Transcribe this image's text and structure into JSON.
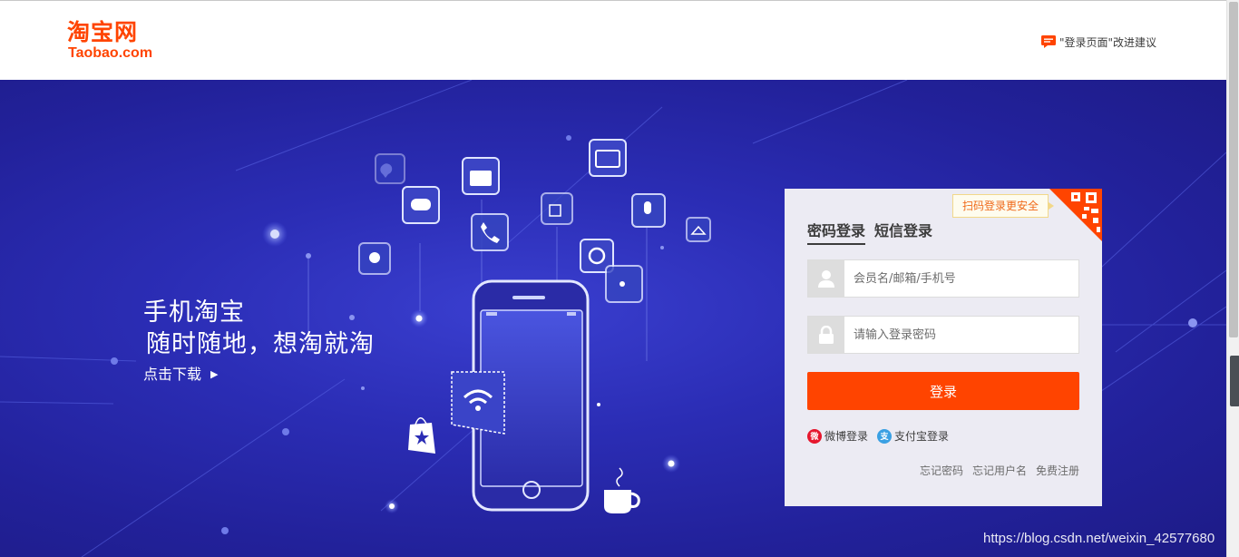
{
  "header": {
    "logo_cn": "淘宝网",
    "logo_en": "Taobao.com",
    "feedback_text": "\"登录页面\"改进建议",
    "icon": "feedback-chat-icon"
  },
  "hero": {
    "slogan_line1": "手机淘宝",
    "slogan_line2": "随时随地，想淘就淘",
    "download_label": "点击下载",
    "download_arrow": "▶"
  },
  "login": {
    "tabs": [
      {
        "label": "密码登录",
        "active": true
      },
      {
        "label": "短信登录",
        "active": false
      }
    ],
    "qr_tip": "扫码登录更安全",
    "username": {
      "placeholder": "会员名/邮箱/手机号",
      "value": "",
      "icon": "user-icon"
    },
    "password": {
      "placeholder": "请输入登录密码",
      "value": "",
      "icon": "lock-icon"
    },
    "submit_label": "登录",
    "thirdparty": [
      {
        "label": "微博登录",
        "icon": "weibo-icon",
        "glyph": "微"
      },
      {
        "label": "支付宝登录",
        "icon": "alipay-icon",
        "glyph": "支"
      }
    ],
    "links": [
      "忘记密码",
      "忘记用户名",
      "免费注册"
    ]
  },
  "watermark": "https://blog.csdn.net/weixin_42577680",
  "colors": {
    "brand": "#ff4400",
    "hero_bg": "#2b2db5",
    "panel_bg": "#ecebf3"
  }
}
